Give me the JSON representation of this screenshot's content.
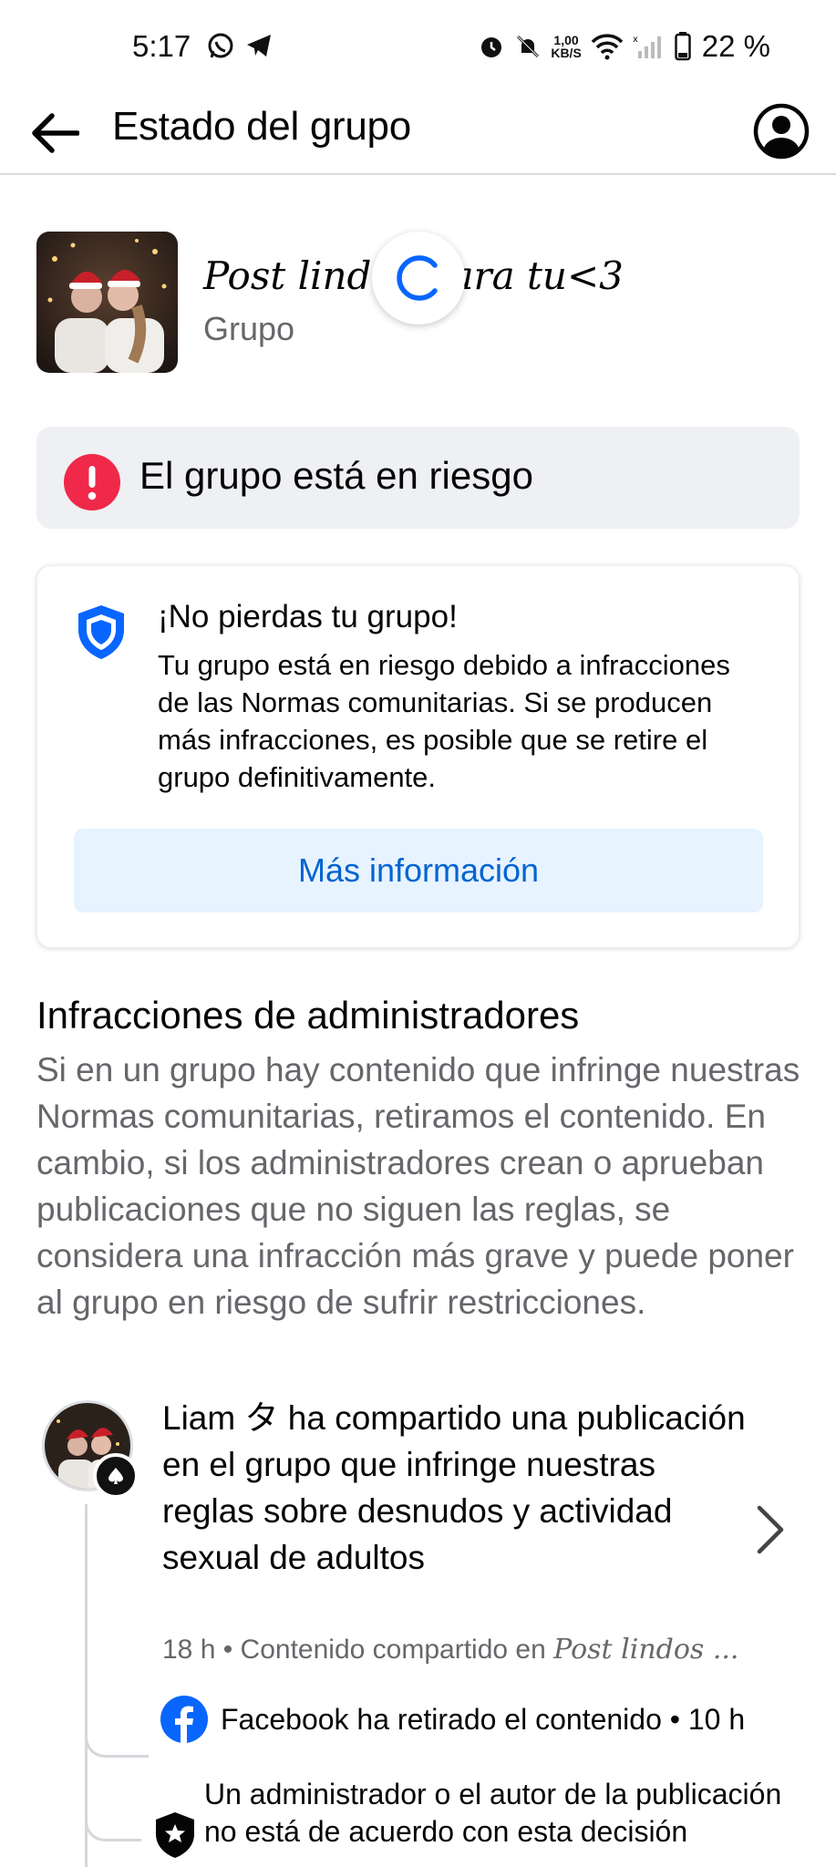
{
  "status_bar": {
    "time": "5:17",
    "net_speed_value": "1,00",
    "net_speed_unit": "KB/S",
    "battery": "22 %"
  },
  "app_bar": {
    "title": "Estado del grupo"
  },
  "group": {
    "name": "Post lindos para tu<3",
    "type": "Grupo"
  },
  "risk_banner": {
    "text": "El grupo está en riesgo"
  },
  "warning_card": {
    "title": "¡No pierdas tu grupo!",
    "body": "Tu grupo está en riesgo debido a infracciones de las Normas comunitarias. Si se producen más infracciones, es posible que se retire el grupo definitivamente.",
    "button_label": "Más información"
  },
  "admin_infractions": {
    "title": "Infracciones de administradores",
    "body": "Si en un grupo hay contenido que infringe nuestras Normas comunitarias, retiramos el contenido. En cambio, si los administradores crean o aprueban publicaciones que no siguen las reglas, se considera una infracción más grave y puede poner al grupo en riesgo de sufrir restricciones."
  },
  "violation": {
    "text": "Liam タ ha compartido una publicación en el grupo que infringe nuestras reglas sobre desnudos y actividad sexual de adultos",
    "meta_prefix": "18 h • Contenido compartido en ",
    "meta_group": "Post lindos ...",
    "removed_text": "Facebook ha retirado el contenido • 10 h",
    "appeal_text": "Un administrador o el autor de la publicación no está de acuerdo con esta decisión"
  },
  "colors": {
    "accent_blue": "#0866ff",
    "link_blue": "#0064d1",
    "alert_red": "#f02849",
    "banner_bg": "#eef0f3",
    "button_bg": "#e7f3ff",
    "secondary_text": "#65676b"
  },
  "icons": {
    "back": "arrow-left-icon",
    "profile": "user-circle-icon",
    "alert": "exclamation-circle-icon",
    "shield": "shield-icon",
    "chevron": "chevron-right-icon",
    "facebook": "facebook-logo-icon",
    "admin": "shield-star-icon"
  }
}
